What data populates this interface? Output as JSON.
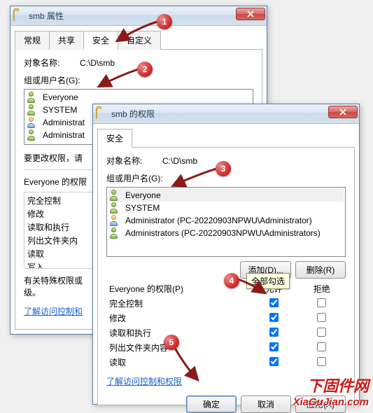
{
  "w1": {
    "title": "smb 属性",
    "tabs": [
      "常规",
      "共享",
      "安全",
      "自定义"
    ],
    "active_tab": 2,
    "object_label": "对象名称:",
    "object_value": "C:\\D\\smb",
    "groups_label": "组或用户名(G):",
    "groups": [
      {
        "name": "Everyone",
        "icon": "group"
      },
      {
        "name": "SYSTEM",
        "icon": "group"
      },
      {
        "name": "Administrat",
        "icon": "single"
      },
      {
        "name": "Administrat",
        "icon": "group"
      }
    ],
    "edit_hint": "要更改权限，请",
    "perm_header": "Everyone 的权限",
    "perms": [
      "完全控制",
      "修改",
      "读取和执行",
      "列出文件夹内",
      "读取",
      "写入"
    ],
    "special_hint": "有关特殊权限或\n级。",
    "link": "了解访问控制和"
  },
  "w2": {
    "title": "smb 的权限",
    "tabs": [
      "安全"
    ],
    "object_label": "对象名称:",
    "object_value": "C:\\D\\smb",
    "groups_label": "组或用户名(G):",
    "groups": [
      {
        "name": "Everyone",
        "icon": "group",
        "sel": true
      },
      {
        "name": "SYSTEM",
        "icon": "group"
      },
      {
        "name": "Administrator (PC-20220903NPWU\\Administrator)",
        "icon": "single"
      },
      {
        "name": "Administrators (PC-20220903NPWU\\Administrators)",
        "icon": "group"
      }
    ],
    "add_btn": "添加(D)...",
    "remove_btn": "删除(R)",
    "perm_header": "Everyone 的权限(P)",
    "allow": "允许",
    "deny": "拒绝",
    "perms": [
      {
        "name": "完全控制",
        "allow": true,
        "deny": false
      },
      {
        "name": "修改",
        "allow": true,
        "deny": false
      },
      {
        "name": "读取和执行",
        "allow": true,
        "deny": false
      },
      {
        "name": "列出文件夹内容",
        "allow": true,
        "deny": false
      },
      {
        "name": "读取",
        "allow": true,
        "deny": false
      }
    ],
    "link": "了解访问控制和权限",
    "ok": "确定",
    "cancel": "取消",
    "apply": "应用(A)"
  },
  "ann": {
    "tooltip": "全部勾选",
    "wm1": "下固件网",
    "wm2": "XiaGuJian.com"
  }
}
